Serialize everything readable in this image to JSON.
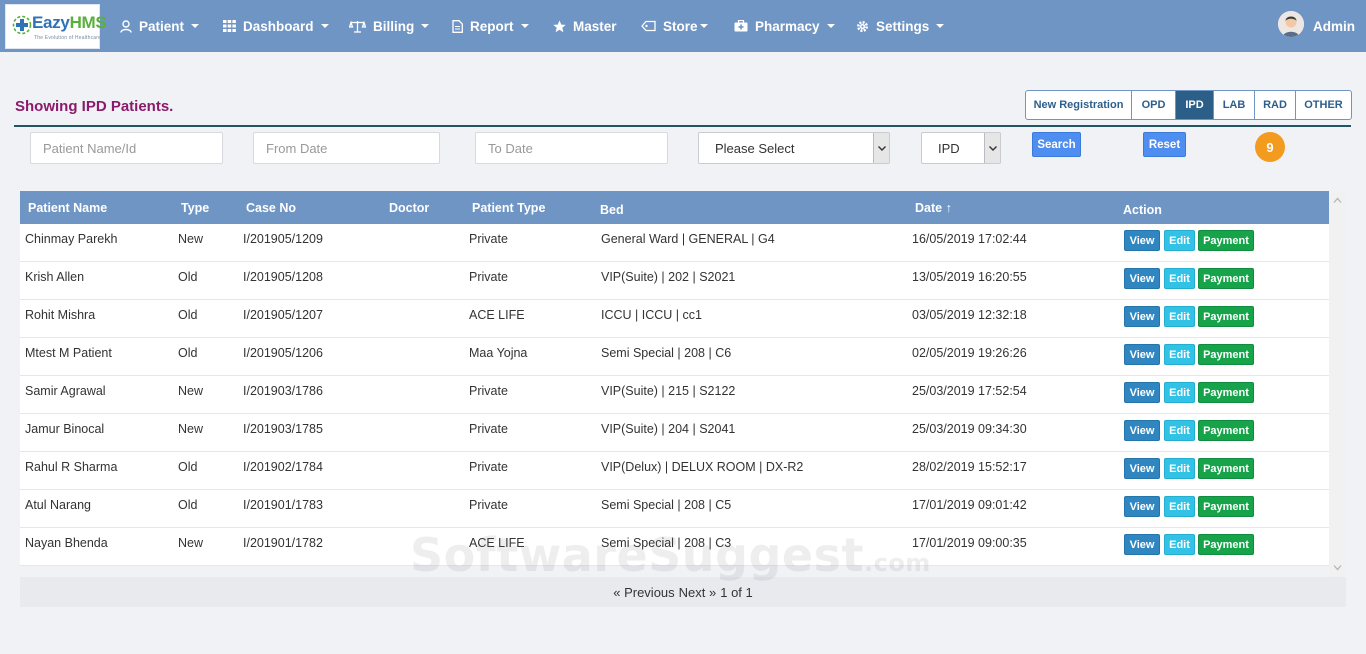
{
  "brand": {
    "name_a": "Eazy",
    "name_b": "HMS",
    "tagline": "The Evolution of Healthcare"
  },
  "nav": {
    "items": [
      {
        "label": "Patient",
        "icon": "user-icon"
      },
      {
        "label": "Dashboard",
        "icon": "grid-icon"
      },
      {
        "label": "Billing",
        "icon": "scale-icon"
      },
      {
        "label": "Report",
        "icon": "document-icon"
      },
      {
        "label": "Master",
        "icon": "star-icon"
      },
      {
        "label": "Store",
        "icon": "tag-icon"
      },
      {
        "label": "Pharmacy",
        "icon": "medkit-icon"
      },
      {
        "label": "Settings",
        "icon": "gear-icon"
      }
    ],
    "user": "Admin"
  },
  "page": {
    "title": "Showing IPD Patients."
  },
  "tabs": [
    {
      "label": "New Registration",
      "active": false
    },
    {
      "label": "OPD",
      "active": false
    },
    {
      "label": "IPD",
      "active": true
    },
    {
      "label": "LAB",
      "active": false
    },
    {
      "label": "RAD",
      "active": false
    },
    {
      "label": "OTHER",
      "active": false
    }
  ],
  "filters": {
    "patient_placeholder": "Patient Name/Id",
    "from_placeholder": "From Date",
    "to_placeholder": "To Date",
    "select_value": "Please Select",
    "type_value": "IPD",
    "search_label": "Search",
    "reset_label": "Reset",
    "count": "9"
  },
  "table": {
    "headers": [
      "Patient Name",
      "Type",
      "Case No",
      "Doctor",
      "Patient Type",
      "Bed",
      "Date ↑",
      "Action"
    ],
    "actions": {
      "view": "View",
      "edit": "Edit",
      "payment": "Payment"
    },
    "rows": [
      {
        "name": "Chinmay Parekh",
        "type": "New",
        "case": "I/201905/1209",
        "doctor": "",
        "ptype": "Private",
        "bed": "General Ward | GENERAL | G4",
        "date": "16/05/2019 17:02:44"
      },
      {
        "name": "Krish Allen",
        "type": "Old",
        "case": "I/201905/1208",
        "doctor": "",
        "ptype": "Private",
        "bed": "VIP(Suite) | 202 | S2021",
        "date": "13/05/2019 16:20:55"
      },
      {
        "name": "Rohit Mishra",
        "type": "Old",
        "case": "I/201905/1207",
        "doctor": "",
        "ptype": "ACE LIFE",
        "bed": "ICCU | ICCU | cc1",
        "date": "03/05/2019 12:32:18"
      },
      {
        "name": "Mtest M Patient",
        "type": "Old",
        "case": "I/201905/1206",
        "doctor": "",
        "ptype": "Maa Yojna",
        "bed": "Semi Special | 208 | C6",
        "date": "02/05/2019 19:26:26"
      },
      {
        "name": "Samir Agrawal",
        "type": "New",
        "case": "I/201903/1786",
        "doctor": "",
        "ptype": "Private",
        "bed": "VIP(Suite) | 215 | S2122",
        "date": "25/03/2019 17:52:54"
      },
      {
        "name": "Jamur Binocal",
        "type": "New",
        "case": "I/201903/1785",
        "doctor": "",
        "ptype": "Private",
        "bed": "VIP(Suite) | 204 | S2041",
        "date": "25/03/2019 09:34:30"
      },
      {
        "name": "Rahul R Sharma",
        "type": "Old",
        "case": "I/201902/1784",
        "doctor": "",
        "ptype": "Private",
        "bed": "VIP(Delux) | DELUX ROOM | DX-R2",
        "date": "28/02/2019 15:52:17"
      },
      {
        "name": "Atul Narang",
        "type": "Old",
        "case": "I/201901/1783",
        "doctor": "",
        "ptype": "Private",
        "bed": "Semi Special | 208 | C5",
        "date": "17/01/2019 09:01:42"
      },
      {
        "name": "Nayan Bhenda",
        "type": "New",
        "case": "I/201901/1782",
        "doctor": "",
        "ptype": "ACE LIFE",
        "bed": "Semi Special | 208 | C3",
        "date": "17/01/2019 09:00:35"
      }
    ]
  },
  "pager": {
    "prev": "« Previous",
    "next": "Next »",
    "info": "1 of 1"
  },
  "watermark": {
    "main": "SoftwareSuggest",
    "suffix": ".com"
  },
  "colors": {
    "nav": "#6f95c5",
    "title": "#8a1b6c",
    "active_tab": "#2b5f88",
    "badge": "#f29b1f",
    "view": "#2f86c1",
    "edit": "#32c2e6",
    "payment": "#16a34a"
  }
}
